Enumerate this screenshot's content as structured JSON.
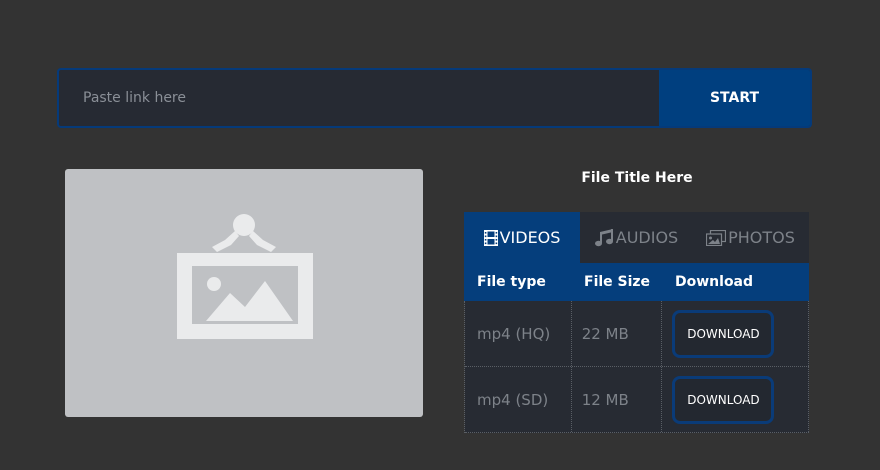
{
  "search": {
    "placeholder": "Paste link here",
    "value": "",
    "start_label": "START"
  },
  "file": {
    "title": "File Title Here",
    "thumbnail_icon": "image-placeholder-icon"
  },
  "tabs": [
    {
      "label": "VIDEOS",
      "icon": "film-icon",
      "active": true
    },
    {
      "label": "AUDIOS",
      "icon": "music-note-icon",
      "active": false
    },
    {
      "label": "PHOTOS",
      "icon": "photos-icon",
      "active": false
    }
  ],
  "table": {
    "headers": [
      "File type",
      "File Size",
      "Download"
    ],
    "rows": [
      {
        "type": "mp4 (HQ)",
        "size": "22 MB",
        "action": "DOWNLOAD"
      },
      {
        "type": "mp4 (SD)",
        "size": "12 MB",
        "action": "DOWNLOAD"
      }
    ]
  },
  "colors": {
    "background": "#333333",
    "accent": "#003f7f",
    "panel": "#272b33",
    "thumbnail": "#bfc1c4"
  }
}
